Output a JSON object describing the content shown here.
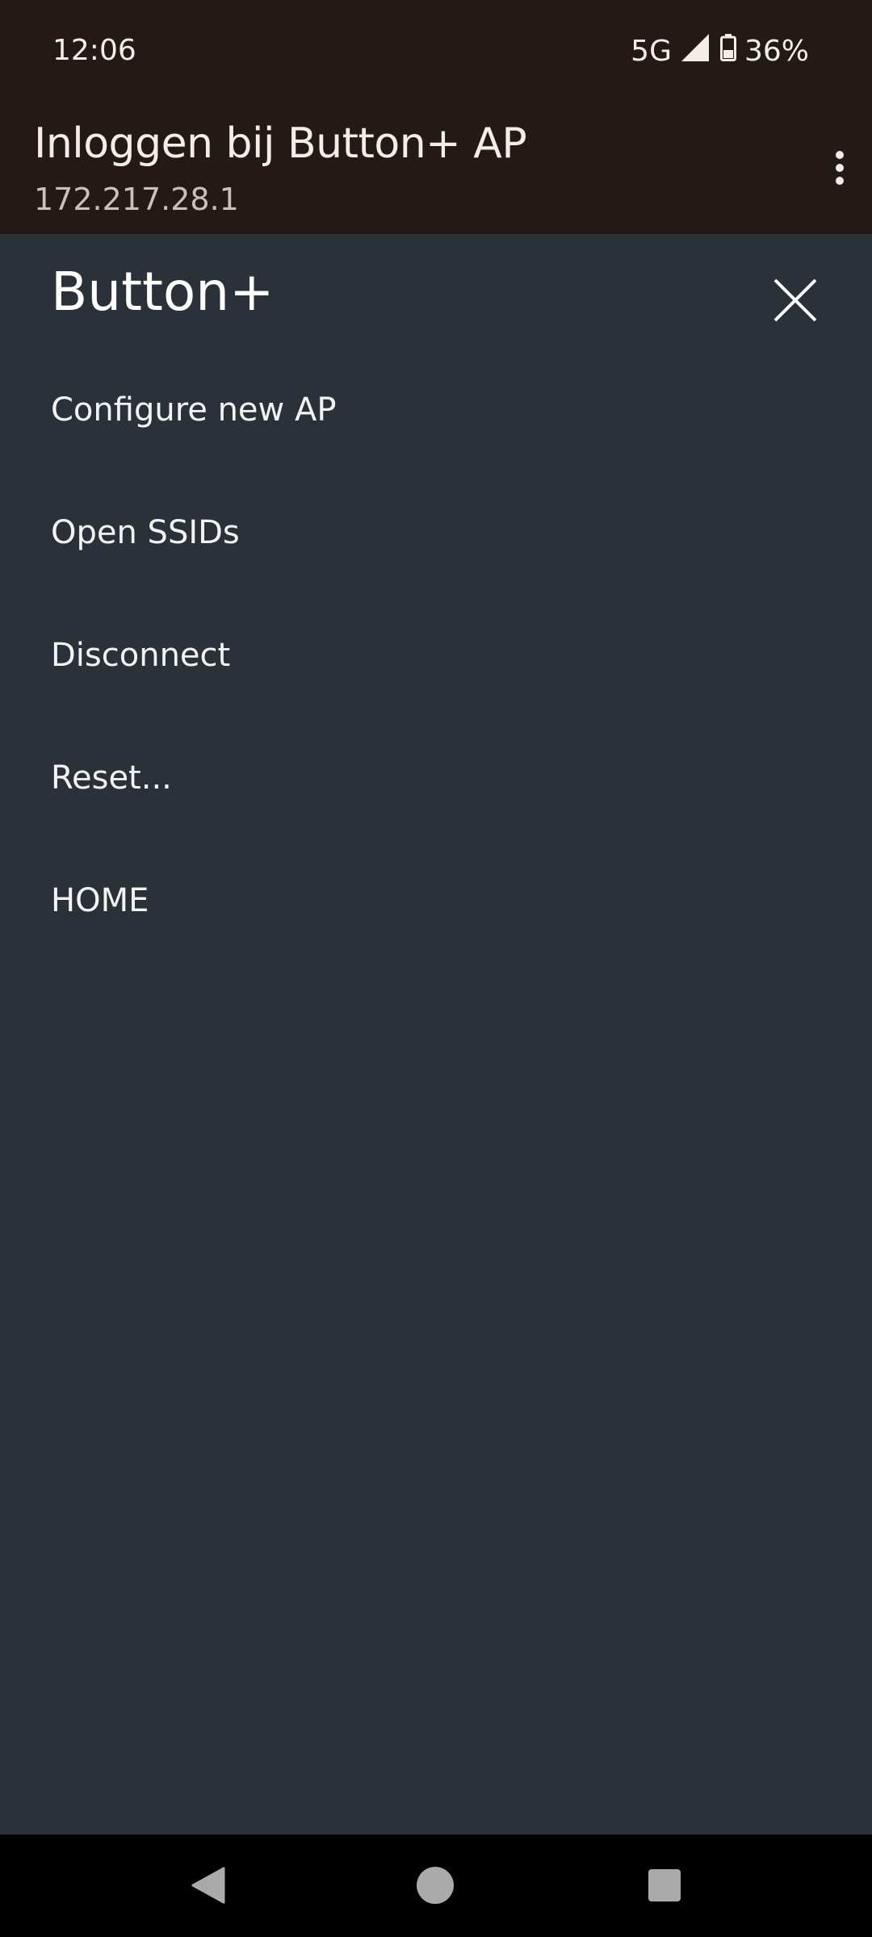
{
  "status_bar": {
    "time": "12:06",
    "network": "5G",
    "battery": "36%"
  },
  "app_bar": {
    "title": "Inloggen bij Button+ AP",
    "subtitle": "172.217.28.1",
    "overflow_icon": "more-vert-icon"
  },
  "panel": {
    "title": "Button+",
    "close_icon": "close-icon",
    "items": [
      {
        "label": "Configure new AP"
      },
      {
        "label": "Open SSIDs"
      },
      {
        "label": "Disconnect"
      },
      {
        "label": "Reset..."
      },
      {
        "label": "HOME"
      }
    ]
  },
  "colors": {
    "top_bar": "#231a18",
    "panel_bg": "#2a3138",
    "nav_bar": "#000000"
  },
  "nav_bar": {
    "back_icon": "back-icon",
    "home_icon": "home-icon",
    "recents_icon": "recents-icon"
  }
}
